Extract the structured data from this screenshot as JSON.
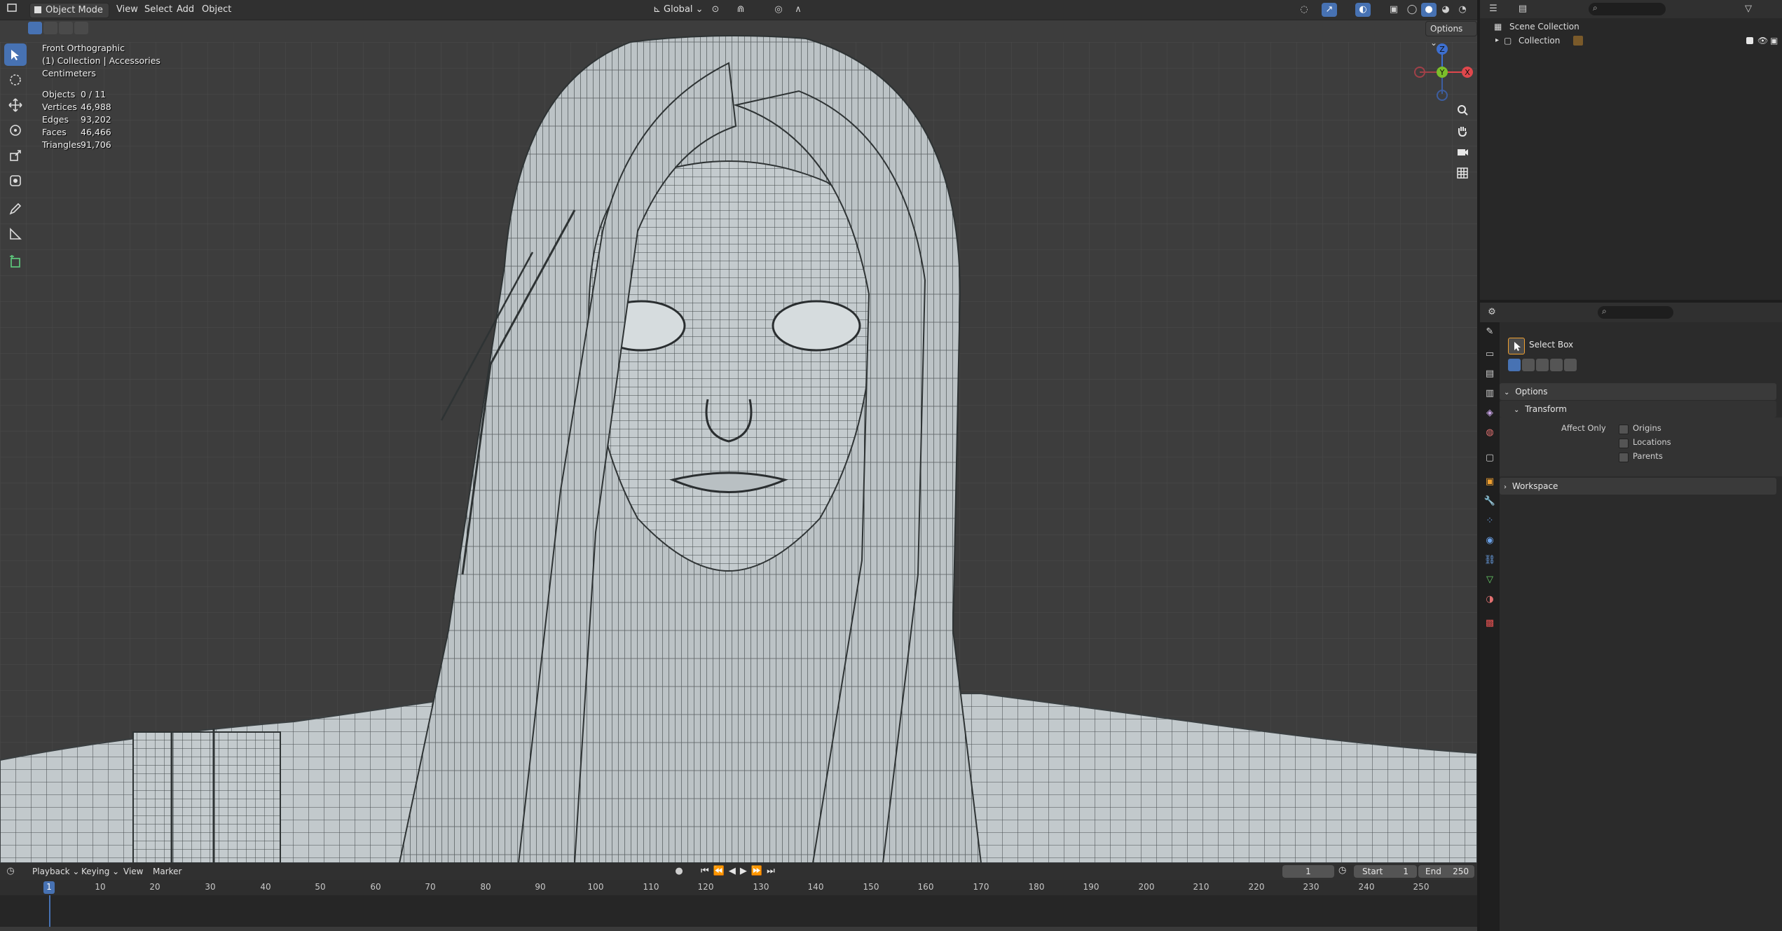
{
  "viewport": {
    "header": {
      "mode": "Object Mode",
      "menus": [
        "View",
        "Select",
        "Add",
        "Object"
      ],
      "orientation": "Global",
      "options_label": "Options"
    },
    "overlay": {
      "view_name": "Front Orthographic",
      "collection_line": "(1) Collection | Accessories",
      "units": "Centimeters",
      "stats": [
        {
          "label": "Objects",
          "value": "0 / 11"
        },
        {
          "label": "Vertices",
          "value": "46,988"
        },
        {
          "label": "Edges",
          "value": "93,202"
        },
        {
          "label": "Faces",
          "value": "46,466"
        },
        {
          "label": "Triangles",
          "value": "91,706"
        }
      ]
    },
    "tools": [
      "select-box",
      "cursor",
      "move",
      "rotate",
      "scale",
      "transform",
      "annotate",
      "measure",
      "add-cube"
    ],
    "gizmo": {
      "x": "X",
      "y": "Y",
      "z": "Z"
    },
    "accent_color": "#4772b3"
  },
  "outliner": {
    "rows": [
      {
        "label": "Scene Collection"
      },
      {
        "label": "Collection"
      }
    ]
  },
  "properties": {
    "tool_name": "Select Box",
    "panels": {
      "options": "Options",
      "transform": "Transform",
      "affect_only": "Affect Only",
      "checkboxes": [
        "Origins",
        "Locations",
        "Parents"
      ],
      "workspace": "Workspace"
    }
  },
  "timeline": {
    "menus": [
      "Playback",
      "Keying",
      "View",
      "Marker"
    ],
    "current_frame": "1",
    "start_label": "Start",
    "start_value": "1",
    "end_label": "End",
    "end_value": "250",
    "ticks": [
      "1",
      "10",
      "20",
      "30",
      "40",
      "50",
      "60",
      "70",
      "80",
      "90",
      "100",
      "110",
      "120",
      "130",
      "140",
      "150",
      "160",
      "170",
      "180",
      "190",
      "200",
      "210",
      "220",
      "230",
      "240",
      "250"
    ]
  }
}
